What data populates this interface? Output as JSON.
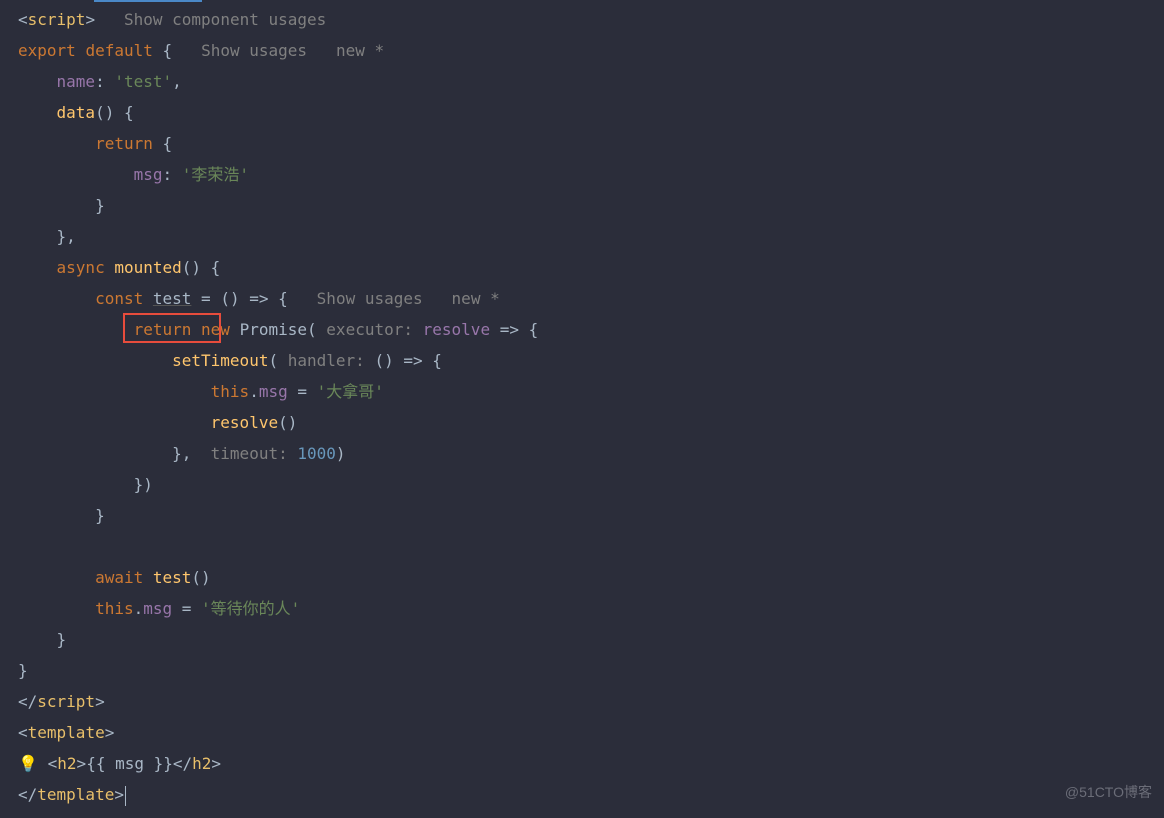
{
  "hints": {
    "showComponentUsages": "Show component usages",
    "showUsages": "Show usages",
    "newStar": "new *",
    "executor": "executor:",
    "handler": "handler:",
    "timeout": "timeout:"
  },
  "tags": {
    "script": "script",
    "template": "template",
    "h2": "h2"
  },
  "keywords": {
    "export": "export",
    "default": "default",
    "return": "return",
    "async": "async",
    "const": "const",
    "new": "new",
    "await": "await",
    "this": "this"
  },
  "props": {
    "name": "name",
    "data": "data",
    "msg": "msg",
    "mounted": "mounted"
  },
  "methods": {
    "setTimeout": "setTimeout",
    "resolve": "resolve",
    "test": "test"
  },
  "classes": {
    "Promise": "Promise"
  },
  "strings": {
    "test": "'test'",
    "lironghao": "'李荣浩'",
    "danage": "'大拿哥'",
    "dengdai": "'等待你的人'"
  },
  "numbers": {
    "thousand": "1000"
  },
  "template": {
    "mustache": "{{ msg }}"
  },
  "watermark": "@51CTO博客",
  "icons": {
    "bulb": "💡"
  }
}
